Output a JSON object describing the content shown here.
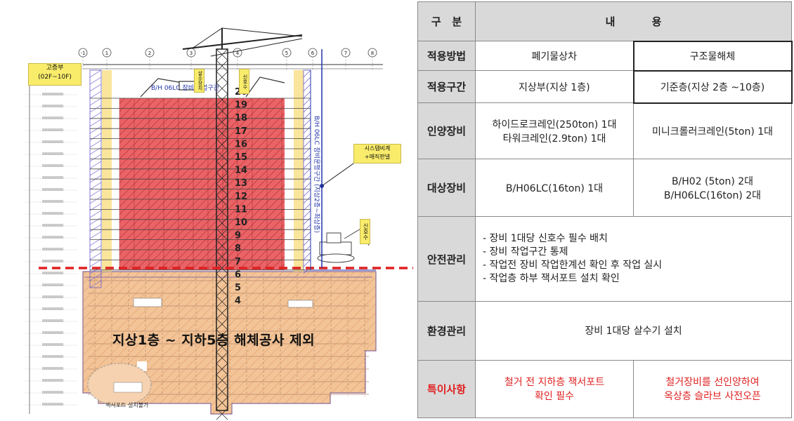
{
  "drawing": {
    "tag_high_rise": "고층부",
    "tag_floors": "(02F~10F)",
    "tag_system": "시스템비계",
    "tag_mesh": "+매직판넬",
    "signal_left": "신호수",
    "signal_right": "신호수",
    "signal_top": "살수장치",
    "bh_label": "B/H 06LC 장비 작업구간",
    "bh_vertical": "B/H 06LC 장비운행구간 (지상2층~최상층)",
    "excluded_text": "지상1층 ~ 지하5층 해체공사 제외",
    "jack_note": "잭서포트 설치불가",
    "floor_numbers": [
      "20",
      "19",
      "18",
      "17",
      "16",
      "15",
      "14",
      "13",
      "12",
      "11",
      "10",
      "9",
      "8",
      "7",
      "6",
      "5",
      "4"
    ],
    "grid_labels": [
      "-1",
      "1",
      "2",
      "3",
      "4",
      "5",
      "6",
      "7",
      "8"
    ]
  },
  "table": {
    "header": {
      "col1": "구   분",
      "col2": "내          용"
    },
    "rows": {
      "law": {
        "label": "적용방법",
        "a": "폐기물상차",
        "b": "구조물해체"
      },
      "section": {
        "label": "적용구간",
        "a": "지상부(지상 1층)",
        "b": "기준층(지상 2층 ~10층)"
      },
      "lifting": {
        "label": "인양장비",
        "a1": "하이드로크레인(250ton) 1대",
        "a2": "타워크레인(2.9ton) 1대",
        "b": "미니크롤러크레인(5ton) 1대"
      },
      "target": {
        "label": "대상장비",
        "a": "B/H06LC(16ton) 1대",
        "b1": "B/H02 (5ton) 2대",
        "b2": "B/H06LC(16ton) 2대"
      },
      "safety": {
        "label": "안전관리",
        "items": [
          "장비 1대당 신호수 필수 배치",
          "장비 작업구간 통제",
          "작업전 장비 작업한계선 확인 후 작업 실시",
          "작업층 하부 잭서포트 설치 확인"
        ]
      },
      "env": {
        "label": "환경관리",
        "text": "장비 1대당 살수기 설치"
      },
      "special": {
        "label": "특이사항",
        "a1": "철거 전 지하층 잭서포트",
        "a2": "확인 필수",
        "b1": "철거장비를 선인양하여",
        "b2": "옥상층 슬라브 사전오픈"
      }
    }
  },
  "colors": {
    "demolition_red": "#e03030",
    "excluded_orange": "#f2c08f",
    "dashed_line": "#e02020",
    "header_gray": "#d9d9d9"
  }
}
